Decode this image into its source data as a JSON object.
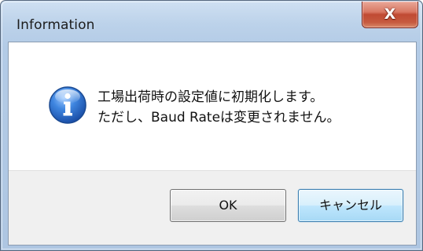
{
  "window": {
    "title": "Information",
    "close_label": "X"
  },
  "dialog": {
    "icon": "information-icon",
    "message_line1": "工場出荷時の設定値に初期化します。",
    "message_line2": "ただし、Baud Rateは変更されません。"
  },
  "buttons": {
    "ok_label": "OK",
    "cancel_label": "キャンセル"
  },
  "colors": {
    "title_bar": "#bcd2ea",
    "close_button": "#c65a3f",
    "info_icon": "#2a6fd0",
    "footer": "#f0f0f0",
    "default_button_border": "#3c7fb1"
  }
}
